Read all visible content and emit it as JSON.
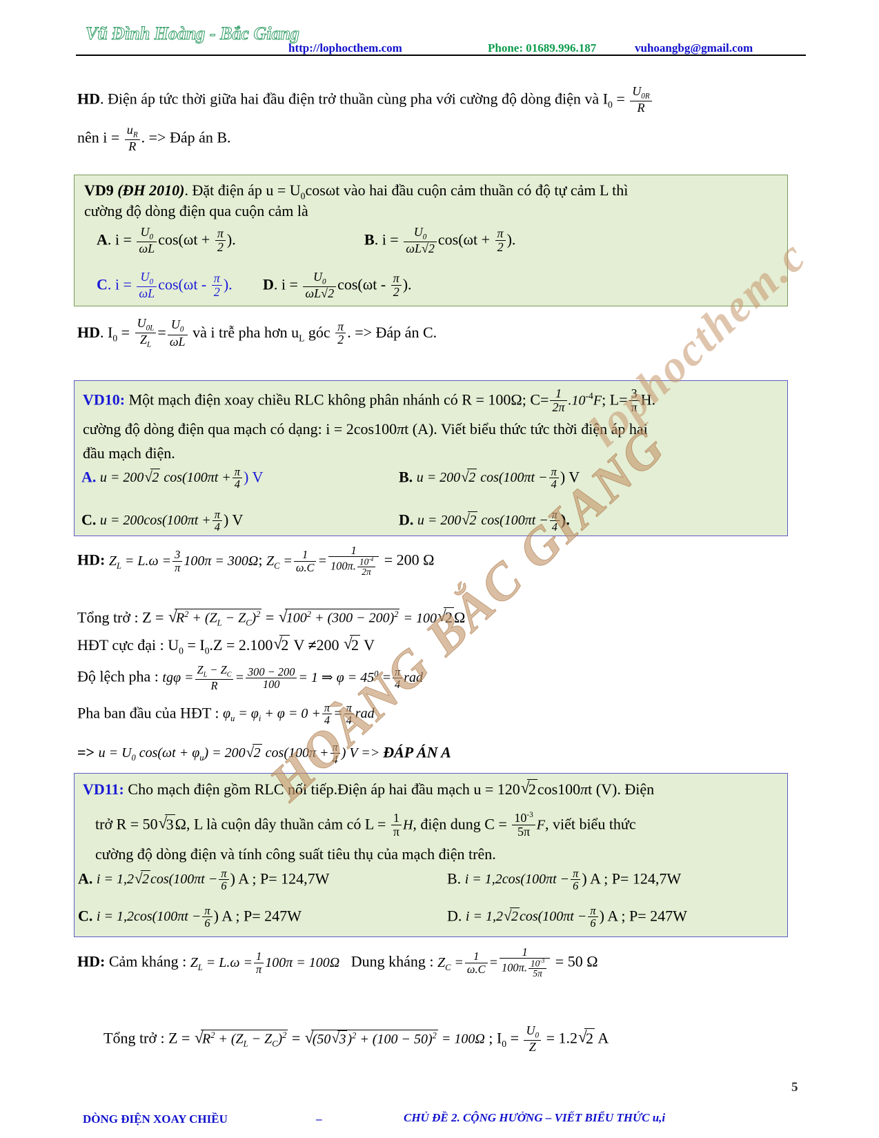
{
  "header": {
    "logo": "Vũ Đình Hoàng - Bắc Giang",
    "url": "http://lophocthem.com",
    "phone": "Phone: 01689.996.187",
    "email": "vuhoangbg@gmail.com"
  },
  "watermark": {
    "line1": "HOÀNG BẮC GIANG",
    "line2": "lophocthem.c"
  },
  "hd_top": {
    "label": "HD",
    "text_1": ". Điện áp tức thời giữa hai đầu điện trở thuần cùng pha với cường độ dòng điện và I",
    "sub_0": "0",
    "eq": " = ",
    "frac_num": "U",
    "frac_num_sub": "0R",
    "frac_den": "R",
    "line2_pre": "nên i = ",
    "line2_num": "u",
    "line2_num_sub": "R",
    "line2_den": "R",
    "line2_post": ". => Đáp án B."
  },
  "vd9": {
    "tag": "VD9",
    "source": "(ĐH 2010)",
    "stem_1": ". Đặt điện áp u = U",
    "stem_sub": "0",
    "stem_2": "cosωt vào hai đầu cuộn cảm thuần có độ tự cảm L thì",
    "stem_3": "cường độ dòng điện qua cuộn cảm là",
    "options": [
      {
        "label": "A",
        "pre": ". i = ",
        "num": "U",
        "num_sub": "0",
        "den": "ωL",
        "mid": "cos(ωt + ",
        "pnum": "π",
        "pden": "2",
        "post": ")."
      },
      {
        "label": "B",
        "pre": ". i = ",
        "num": "U",
        "num_sub": "0",
        "den": "ωL√2",
        "mid": "cos(ωt + ",
        "pnum": "π",
        "pden": "2",
        "post": ")."
      },
      {
        "label": "C",
        "pre": ". i = ",
        "num": "U",
        "num_sub": "0",
        "den": "ωL",
        "mid": "cos(ωt - ",
        "pnum": "π",
        "pden": "2",
        "post": ")."
      },
      {
        "label": "D",
        "pre": ". i = ",
        "num": "U",
        "num_sub": "0",
        "den": "ωL√2",
        "mid": "cos(ωt - ",
        "pnum": "π",
        "pden": "2",
        "post": ")."
      }
    ],
    "highlight": "C"
  },
  "hd9": {
    "label": "HD",
    "pre": ". I",
    "sub0": "0",
    "eq": " = ",
    "f1_num": "U",
    "f1_num_sub": "0L",
    "f1_den": "Z",
    "f1_den_sub": "L",
    "eq2": "=",
    "f2_num": "U",
    "f2_num_sub": "0",
    "f2_den": "ωL",
    "mid": " và i trễ pha hơn u",
    "sub_L": "L",
    "mid2": " góc ",
    "f3_num": "π",
    "f3_den": "2",
    "post": ". => Đáp án C."
  },
  "vd10": {
    "tag": "VD10:",
    "stem_1": "Một mạch điện xoay chiều RLC không phân nhánh có R = 100",
    "ohm": "Ω",
    "stem_2": "; C=",
    "c_num": "1",
    "c_den": "2π",
    "c_post": ".10",
    "c_exp": "-4",
    "c_unit": "F",
    "stem_3": "; L=",
    "l_num": "3",
    "l_den": "π",
    "l_unit": "H.",
    "stem_4": "cường độ dòng điện qua mạch có dạng: i = 2cos100",
    "pi": "π",
    "stem_5": "t (A). Viết biểu thức tức thời  điện áp hai",
    "stem_6": "đầu mạch điện.",
    "options": [
      {
        "label": "A.",
        "expr": "u = 200",
        "rad": "2",
        "cos": "cos(100πt +",
        "pnum": "π",
        "pden": "4",
        "post": ") V"
      },
      {
        "label": "B.",
        "expr": "u = 200",
        "rad": "2",
        "cos": "cos(100πt −",
        "pnum": "π",
        "pden": "4",
        "post": ") V"
      },
      {
        "label": "C.",
        "expr": "u = 200",
        "rad": "",
        "cos": "cos(100πt +",
        "pnum": "π",
        "pden": "4",
        "post": ") V"
      },
      {
        "label": "D.",
        "expr": "u = 200",
        "rad": "2",
        "cos": "cos(100πt −",
        "pnum": "π",
        "pden": "4",
        "post": ")."
      }
    ],
    "highlight": "A."
  },
  "hd10": {
    "label": "HD:",
    "l1_zl": "Z",
    "l1_zl_sub": "L",
    "l1_eq": " = L.ω =",
    "l1_num": "3",
    "l1_den": "π",
    "l1_rest": "100π = 300Ω",
    "l1_semi": ";",
    "l1_zc": "Z",
    "l1_zc_sub": "C",
    "l1_eq2": " =",
    "l1_f2_num": "1",
    "l1_f2_den": "ω.C",
    "l1_eq3": "=",
    "l1_f3_num": "1",
    "l1_f3_den_pre": "100π.",
    "l1_f3_den_num": "10",
    "l1_f3_den_exp": "-4",
    "l1_f3_den_den": "2π",
    "l1_result": "= 200  Ω",
    "l2_label": "Tổng trở : Z = ",
    "l2_r1": "R",
    "l2_r1_sup": "2",
    "l2_plus": " + (Z",
    "l2_zl_sub": "L",
    "l2_minus": " − Z",
    "l2_zc_sub": "C",
    "l2_close": ")",
    "l2_close_sup": "2",
    "l2_eq": " = ",
    "l2_r2": "100",
    "l2_r2_sup": "2",
    "l2_r2b": " + (300 − 200)",
    "l2_r2b_sup": "2",
    "l2_result_pre": " = 100",
    "l2_result_rad": "2",
    "l2_result_post": "Ω",
    "l3": "HĐT cực đại : U",
    "l3_sub": "0",
    "l3_b": " = I",
    "l3_sub2": "0",
    "l3_c": ".Z = 2.100",
    "l3_rad": "2",
    "l3_d": " V ",
    "l3_neq": "≠",
    "l3_e": "200 ",
    "l3_rad2": "2",
    "l3_f": " V",
    "l4_label": "Độ lệch pha : ",
    "l4_tg": "tgφ =",
    "l4_num": "Z",
    "l4_num_sub": "L",
    "l4_num_b": " − Z",
    "l4_num_sub2": "C",
    "l4_den": "R",
    "l4_eq": "=",
    "l4_f2_num": "300 − 200",
    "l4_f2_den": "100",
    "l4_rest": "= 1 ⇒ φ = 45",
    "l4_deg": "0",
    "l4_eq2": " =",
    "l4_f3_num": "π",
    "l4_f3_den": "4",
    "l4_rad_unit": "rad",
    "l5_label": "Pha ban đầu của HĐT : ",
    "l5_phi_u": "φ",
    "l5_phi_u_sub": "u",
    "l5_eq": " = φ",
    "l5_phi_i_sub": "i",
    "l5_plus": " + φ = 0 +",
    "l5_f1_num": "π",
    "l5_f1_den": "4",
    "l5_eq2": "=",
    "l5_f2_num": "π",
    "l5_f2_den": "4",
    "l5_unit": "rad",
    "l6_pre": "=> ",
    "l6_u": "u",
    "l6_a": " = U",
    "l6_sub": "0",
    "l6_b": " cos(ωt + φ",
    "l6_sub2": "u",
    "l6_c": ") = 200",
    "l6_rad": "2",
    "l6_d": " cos(100π +",
    "l6_f_num": "π",
    "l6_f_den": "4",
    "l6_e": ") V => ",
    "l6_ans": "ĐÁP ÁN A"
  },
  "vd11": {
    "tag": "VD11:",
    "stem_1": "Cho mạch điện gồm RLC nối tiếp.Điện áp hai đầu mạch  u = 120",
    "rad1": "2",
    "stem_2": "cos100",
    "pi": "π",
    "stem_3": "t (V). Điện",
    "stem_4": "trở R = 50",
    "rad2": "3",
    "stem_5": "Ω, L là cuộn dây thuần cảm có  L = ",
    "l_num": "1",
    "l_den": "π",
    "l_unit": "H",
    "stem_6": ", điện dung C = ",
    "c_num": "10",
    "c_exp": "-3",
    "c_den": "5π",
    "c_unit": "F",
    "stem_7": ", viết biểu thức",
    "stem_8": "cường độ dòng điện và tính công suất tiêu thụ của mạch điện  trên.",
    "options": [
      {
        "label": "A.",
        "expr": "i = 1,2",
        "rad": "2",
        "cos": "cos(100πt −",
        "pnum": "π",
        "pden": "6",
        "post": ")  A ; P= 124,7W"
      },
      {
        "label": "B.",
        "expr": "i = 1,2",
        "rad": "",
        "cos": "cos(100πt −",
        "pnum": "π",
        "pden": "6",
        "post": ")  A ; P= 124,7W"
      },
      {
        "label": "C.",
        "expr": "i = 1,2",
        "rad": "",
        "cos": "cos(100πt −",
        "pnum": "π",
        "pden": "6",
        "post": ")  A ; P= 247W"
      },
      {
        "label": "D.",
        "expr": "i = 1,2",
        "rad": "2",
        "cos": "cos(100πt −",
        "pnum": "π",
        "pden": "6",
        "post": ")  A ; P= 247W"
      }
    ]
  },
  "hd11": {
    "label": "HD:",
    "l1_a": "Cảm kháng : ",
    "l1_zl": "Z",
    "l1_zl_sub": "L",
    "l1_eq": " = L.ω =",
    "l1_num": "1",
    "l1_den": "π",
    "l1_rest": "100π = 100Ω",
    "l1_b": "Dung kháng : ",
    "l1_zc": "Z",
    "l1_zc_sub": "C",
    "l1_eq2": " =",
    "l1_f2_num": "1",
    "l1_f2_den": "ω.C",
    "l1_eq3": "=",
    "l1_f3_num": "1",
    "l1_f3_den_pre": "100π.",
    "l1_f3_den_num": "10",
    "l1_f3_den_exp": "-3",
    "l1_f3_den_den": "5π",
    "l1_result": "= 50  Ω",
    "l2_label": "Tổng trở : Z = ",
    "l2_r1": "R",
    "l2_r1_sup": "2",
    "l2_plus": " + (Z",
    "l2_zl_sub": "L",
    "l2_minus": " − Z",
    "l2_zc_sub": "C",
    "l2_close": ")",
    "l2_close_sup": "2",
    "l2_eq": " = ",
    "l2_r2_pre": "(50",
    "l2_r2_rad": "3",
    "l2_r2_post": ")",
    "l2_r2_sup": "2",
    "l2_r2b": " + (100 − 50)",
    "l2_r2b_sup": "2",
    "l2_result": " = 100Ω",
    "l2_semi": " ; I",
    "l2_sub": "0",
    "l2_eq2": " = ",
    "l2_f_num": "U",
    "l2_f_num_sub": "0",
    "l2_f_den": "Z",
    "l2_final": " = 1.2",
    "l2_final_rad": "2",
    "l2_unit": " A"
  },
  "footer": {
    "left": "DÒNG ĐIỆN XOAY CHIỀU",
    "dash": "–",
    "right": "CHỦ ĐỀ 2. CỘNG HƯỞNG – VIẾT BIỂU THỨC u,i",
    "page": "5"
  }
}
